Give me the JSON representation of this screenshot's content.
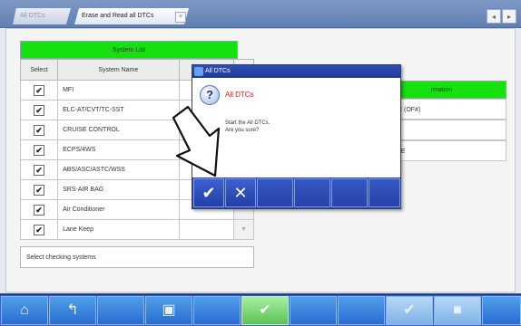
{
  "tabs": [
    {
      "label": "All DTCs"
    },
    {
      "label": "Erase and Read all DTCs"
    }
  ],
  "tab_close_glyph": "×",
  "nav": {
    "prev_glyph": "◂",
    "next_glyph": "▸"
  },
  "system_list": {
    "title": "System List",
    "headers": {
      "select": "Select",
      "name": "System Name"
    },
    "rows": [
      {
        "name": "MFI",
        "checked": true
      },
      {
        "name": "ELC-AT/CVT/TC-SST",
        "checked": true
      },
      {
        "name": "CRUISE CONTROL",
        "checked": true
      },
      {
        "name": "ECPS/4WS",
        "checked": true
      },
      {
        "name": "ABS/ASC/ASTC/WSS",
        "checked": true
      },
      {
        "name": "SRS-AIR BAG",
        "checked": true
      },
      {
        "name": "Air Conditioner",
        "checked": true
      },
      {
        "name": "Lane Keep",
        "checked": true
      }
    ],
    "checkmark": "✔",
    "scroll_down_glyph": "▼"
  },
  "status_text": "Select checking systems",
  "right_table": {
    "header": "rmation",
    "cells": [
      "R (OF#)",
      "",
      "LE"
    ]
  },
  "dialog": {
    "title": "All DTCs",
    "icon": "question-icon",
    "q_glyph": "?",
    "heading": "All DTCs",
    "message": "Start the All DTCs.\nAre you sure?",
    "ok_glyph": "✔",
    "cancel_glyph": "✕"
  },
  "toolbar": {
    "icons": [
      "home-icon",
      "back-icon",
      "blank",
      "print-icon",
      "blank",
      "confirm-icon",
      "blank",
      "blank",
      "check-icon",
      "square-icon",
      "blank"
    ],
    "confirm_glyph": "✔",
    "check_glyph": "✔",
    "square_glyph": "■",
    "back_glyph": "↰",
    "home_glyph": "⌂",
    "print_glyph": "▣"
  },
  "colors": {
    "header_green": "#17e00f",
    "dialog_blue": "#2a45a7",
    "toolbar_blue": "#3a5fc2",
    "heading_red": "#e01515"
  }
}
